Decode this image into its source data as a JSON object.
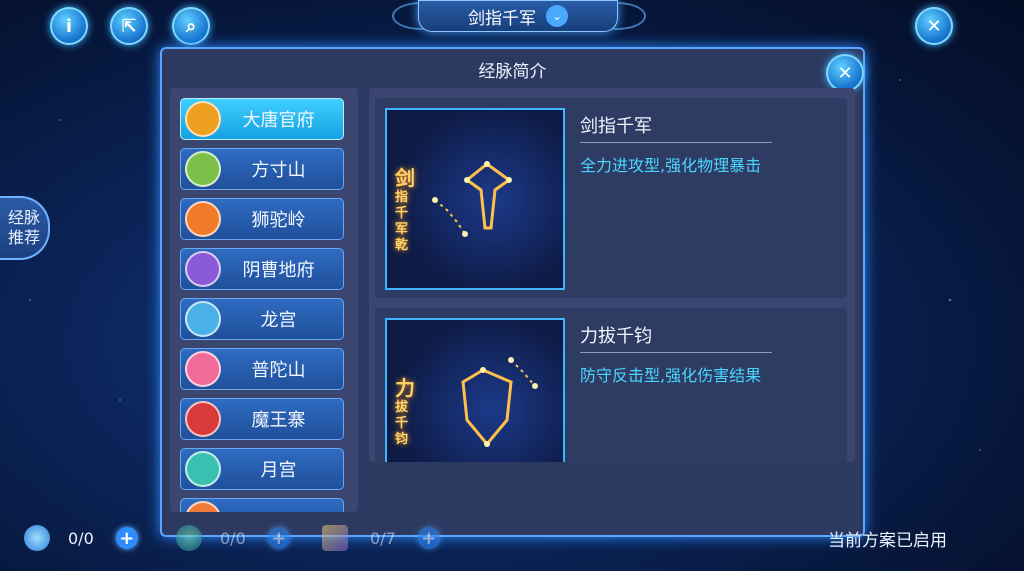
{
  "header": {
    "title": "剑指千军",
    "icons": [
      "info-icon",
      "share-icon",
      "search-icon"
    ],
    "info_glyph": "i",
    "share_glyph": "⇱",
    "search_glyph": "⌕",
    "close_glyph": "✕",
    "chevron_glyph": "⌄"
  },
  "side_tab": {
    "label_line1": "经脉",
    "label_line2": "推荐"
  },
  "dialog": {
    "title": "经脉简介",
    "close_glyph": "✕",
    "factions": [
      {
        "name": "大唐官府",
        "active": true,
        "color": "#f0a020"
      },
      {
        "name": "方寸山",
        "active": false,
        "color": "#7cc04a"
      },
      {
        "name": "狮驼岭",
        "active": false,
        "color": "#f07a2a"
      },
      {
        "name": "阴曹地府",
        "active": false,
        "color": "#8a5ad8"
      },
      {
        "name": "龙宫",
        "active": false,
        "color": "#4ab0e8"
      },
      {
        "name": "普陀山",
        "active": false,
        "color": "#f06a9a"
      },
      {
        "name": "魔王寨",
        "active": false,
        "color": "#d83a3a"
      },
      {
        "name": "月宫",
        "active": false,
        "color": "#3ac0b0"
      }
    ],
    "schools": [
      {
        "name": "剑指千军",
        "desc": "全力进攻型,强化物理暴击",
        "glyph_big": "剑",
        "glyph_small": [
          "指",
          "千",
          "军",
          "乾"
        ]
      },
      {
        "name": "力拔千钧",
        "desc": "防守反击型,强化伤害结果",
        "glyph_big": "力",
        "glyph_small": [
          "拔",
          "千",
          "钧"
        ]
      }
    ]
  },
  "bottom_bar": {
    "res1": "0/0",
    "res2": "0/0",
    "res3": "0/7",
    "plus_glyph": "+",
    "status": "当前方案已启用"
  }
}
